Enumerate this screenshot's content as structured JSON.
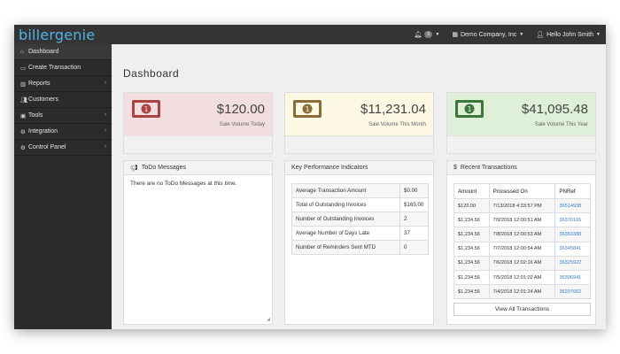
{
  "app": {
    "logo": "billergenie"
  },
  "topbar": {
    "notifications_count": "0",
    "company": "Demo Company, Inc",
    "user_greeting": "Hello John Smith"
  },
  "sidebar": {
    "items": [
      {
        "label": "Dashboard",
        "icon": "home-icon"
      },
      {
        "label": "Create Transaction",
        "icon": "card-icon"
      },
      {
        "label": "Reports",
        "icon": "bar-chart-icon"
      },
      {
        "label": "Customers",
        "icon": "users-icon"
      },
      {
        "label": "Tools",
        "icon": "briefcase-icon"
      },
      {
        "label": "Integration",
        "icon": "gear-icon"
      },
      {
        "label": "Control Panel",
        "icon": "gears-icon"
      }
    ]
  },
  "main": {
    "title": "Dashboard"
  },
  "stats": [
    {
      "amount": "$120.00",
      "label": "Sale Volume Today",
      "bg": "#f2dede",
      "bottom": "#f1f1f1",
      "icon_color": "#a94442"
    },
    {
      "amount": "$11,231.04",
      "label": "Sale Volume This Month",
      "bg": "#fcf8e3",
      "bottom": "#f1f1f1",
      "icon_color": "#8a6d3b"
    },
    {
      "amount": "$41,095.48",
      "label": "Sale Volume This Year",
      "bg": "#dff0d8",
      "bottom": "#f1f1f1",
      "icon_color": "#3c763d"
    }
  ],
  "todo": {
    "title": "ToDo Messages",
    "empty_text": "There are no ToDo Messages at this time."
  },
  "kpi": {
    "title": "Key Performance Indicators",
    "rows": [
      {
        "label": "Average Transaction Amount",
        "value": "$0.00"
      },
      {
        "label": "Total of Outstanding Invoices",
        "value": "$165.00"
      },
      {
        "label": "Number of Outstanding Invoices",
        "value": "2"
      },
      {
        "label": "Average Number of Days Late",
        "value": "37"
      },
      {
        "label": "Number of Reminders Sent MTD",
        "value": "0"
      }
    ]
  },
  "transactions": {
    "title": "Recent Transactions",
    "columns": [
      "Amount",
      "Processed On",
      "PNRef"
    ],
    "rows": [
      {
        "amount": "$120.00",
        "processed_on": "7/13/2018 4:33:57 PM",
        "pnref": "36514938"
      },
      {
        "amount": "$1,234.56",
        "processed_on": "7/9/2018 12:00:51 AM",
        "pnref": "36370165"
      },
      {
        "amount": "$1,234.56",
        "processed_on": "7/8/2018 12:00:53 AM",
        "pnref": "36359388"
      },
      {
        "amount": "$1,234.56",
        "processed_on": "7/7/2018 12:00:54 AM",
        "pnref": "36345841"
      },
      {
        "amount": "$1,234.56",
        "processed_on": "7/6/2018 12:02:16 AM",
        "pnref": "36325922"
      },
      {
        "amount": "$1,234.56",
        "processed_on": "7/5/2018 12:01:02 AM",
        "pnref": "36306941"
      },
      {
        "amount": "$1,234.56",
        "processed_on": "7/4/2018 12:01:24 AM",
        "pnref": "36297662"
      }
    ],
    "view_all_label": "View All Transactions"
  }
}
